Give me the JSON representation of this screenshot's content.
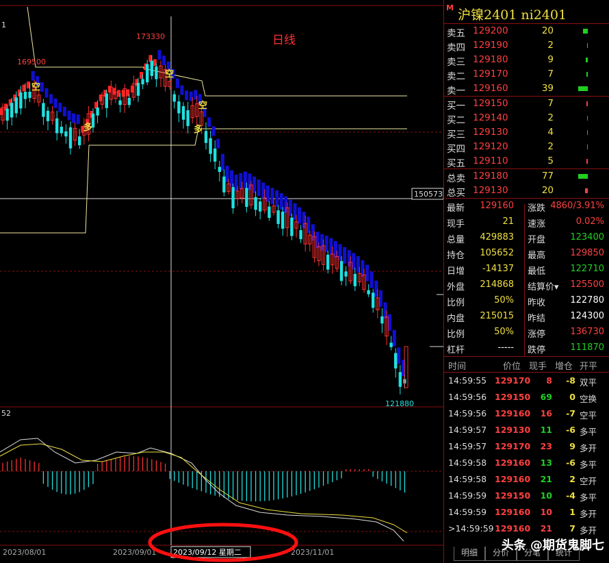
{
  "chart": {
    "period_label": "日线",
    "high_label": "173330",
    "left_high_label": "169500",
    "low_label": "121880",
    "price_tag": "150573",
    "top_tag": "1",
    "macd_tag": "52",
    "signals": {
      "kong1": "空",
      "kong2": "空",
      "kong3": "空",
      "duo1": "多",
      "duo2": "多"
    },
    "dates": [
      "2023/08/01",
      "2023/09/01",
      "2023/09/12 星期二",
      "2023/11/01"
    ],
    "colors": {
      "up": "#ff3030",
      "down": "#20e0e0",
      "ribbon_up": "#ff2020",
      "ribbon_down": "#1010d0",
      "line": "#f0e8a0"
    }
  },
  "header": {
    "badge": "M",
    "title": "沪镍2401  ni2401"
  },
  "orderbook": {
    "asks": [
      {
        "label": "卖五",
        "price": "129200",
        "qty": "20",
        "bar": 0.35
      },
      {
        "label": "卖四",
        "price": "129190",
        "qty": "2",
        "bar": 0.04
      },
      {
        "label": "卖三",
        "price": "129180",
        "qty": "9",
        "bar": 0.16
      },
      {
        "label": "卖二",
        "price": "129170",
        "qty": "7",
        "bar": 0.12
      },
      {
        "label": "卖一",
        "price": "129160",
        "qty": "39",
        "bar": 0.68
      }
    ],
    "bids": [
      {
        "label": "买一",
        "price": "129150",
        "qty": "7",
        "bar": 0.12
      },
      {
        "label": "买二",
        "price": "129140",
        "qty": "2",
        "bar": 0.04
      },
      {
        "label": "买三",
        "price": "129130",
        "qty": "4",
        "bar": 0.07
      },
      {
        "label": "买四",
        "price": "129120",
        "qty": "2",
        "bar": 0.04
      },
      {
        "label": "买五",
        "price": "129110",
        "qty": "5",
        "bar": 0.09
      }
    ],
    "totals": [
      {
        "label": "总卖",
        "price": "129180",
        "qty": "77",
        "bar": 0.68,
        "color": "#20d020"
      },
      {
        "label": "总买",
        "price": "129130",
        "qty": "20",
        "bar": 0.18,
        "color": "#ff4040"
      }
    ]
  },
  "stats": [
    {
      "l1": "最新",
      "v1": "129160",
      "c1": "red",
      "l2": "涨跌",
      "v2": "4860/3.91%",
      "c2": "red"
    },
    {
      "l1": "现手",
      "v1": "21",
      "c1": "yel",
      "l2": "速涨",
      "v2": "0.02%",
      "c2": "red"
    },
    {
      "l1": "总量",
      "v1": "429883",
      "c1": "yel",
      "l2": "开盘",
      "v2": "123400",
      "c2": "grn"
    },
    {
      "l1": "持仓",
      "v1": "105652",
      "c1": "yel",
      "l2": "最高",
      "v2": "129850",
      "c2": "red"
    },
    {
      "l1": "日增",
      "v1": "-14137",
      "c1": "yel",
      "l2": "最低",
      "v2": "122710",
      "c2": "grn"
    },
    {
      "l1": "外盘",
      "v1": "214868",
      "c1": "yel",
      "l2": "结算价▾",
      "v2": "125500",
      "c2": "red"
    },
    {
      "l1": "比例",
      "v1": "50%",
      "c1": "yel",
      "l2": "昨收",
      "v2": "122780",
      "c2": "wht"
    },
    {
      "l1": "内盘",
      "v1": "215015",
      "c1": "yel",
      "l2": "昨结",
      "v2": "124300",
      "c2": "wht"
    },
    {
      "l1": "比例",
      "v1": "50%",
      "c1": "yel",
      "l2": "涨停",
      "v2": "136730",
      "c2": "red"
    },
    {
      "l1": "杠杆",
      "v1": "-----",
      "c1": "wht",
      "l2": "跌停",
      "v2": "111870",
      "c2": "grn"
    }
  ],
  "ticks_header": {
    "time": "时间",
    "price": "价位",
    "size": "现手",
    "inc": "增仓",
    "type": "开平"
  },
  "ticks": [
    {
      "time": "14:59:55",
      "price": "129170",
      "size": "8",
      "sc": "red",
      "inc": "-8",
      "ic": "yel",
      "type": "双平"
    },
    {
      "time": "14:59:56",
      "price": "129150",
      "size": "69",
      "sc": "grn",
      "inc": "0",
      "ic": "yel",
      "type": "空换"
    },
    {
      "time": "14:59:56",
      "price": "129160",
      "size": "16",
      "sc": "red",
      "inc": "-7",
      "ic": "yel",
      "type": "空平"
    },
    {
      "time": "14:59:57",
      "price": "129130",
      "size": "11",
      "sc": "grn",
      "inc": "-6",
      "ic": "yel",
      "type": "多平"
    },
    {
      "time": "14:59:57",
      "price": "129170",
      "size": "23",
      "sc": "red",
      "inc": "9",
      "ic": "yel",
      "type": "多开"
    },
    {
      "time": "14:59:58",
      "price": "129160",
      "size": "13",
      "sc": "grn",
      "inc": "-6",
      "ic": "yel",
      "type": "多平"
    },
    {
      "time": "14:59:58",
      "price": "129160",
      "size": "21",
      "sc": "grn",
      "inc": "2",
      "ic": "yel",
      "type": "空开"
    },
    {
      "time": "14:59:59",
      "price": "129150",
      "size": "10",
      "sc": "grn",
      "inc": "-4",
      "ic": "yel",
      "type": "多平"
    },
    {
      "time": "14:59:59",
      "price": "129160",
      "size": "10",
      "sc": "red",
      "inc": "1",
      "ic": "yel",
      "type": "多开"
    },
    {
      "time": ">14:59:59",
      "price": "129160",
      "size": "21",
      "sc": "red",
      "inc": "7",
      "ic": "yel",
      "type": "多开"
    }
  ],
  "tabs": [
    "明细",
    "分价",
    "分笔",
    "统计"
  ],
  "watermark": "头条 @期货鬼脚七"
}
